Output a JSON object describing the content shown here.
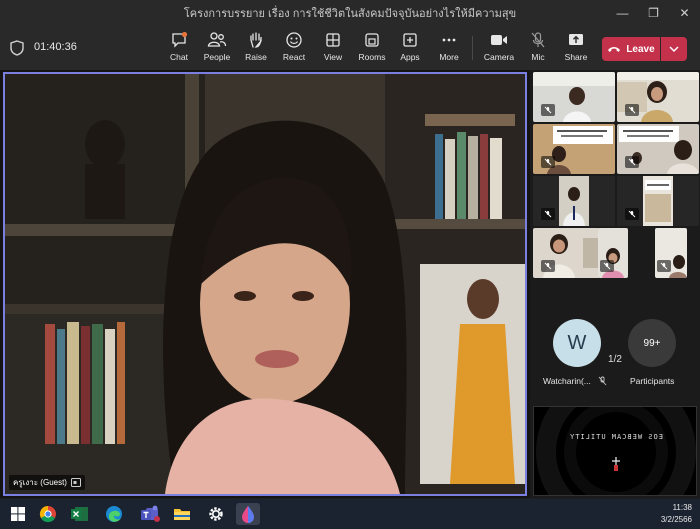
{
  "window": {
    "title": "โครงการบรรยาย เรื่อง การใช้ชีวิตในสังคมปัจจุบันอย่างไรให้มีความสุข",
    "minimize_icon": "minimize-icon",
    "maximize_icon": "restore-icon",
    "close_icon": "close-icon"
  },
  "meeting": {
    "timer": "01:40:36",
    "toolbar": [
      {
        "label": "Chat",
        "icon": "chat-icon"
      },
      {
        "label": "People",
        "icon": "people-icon"
      },
      {
        "label": "Raise",
        "icon": "raise-hand-icon"
      },
      {
        "label": "React",
        "icon": "smiley-icon"
      },
      {
        "label": "View",
        "icon": "grid-view-icon"
      },
      {
        "label": "Rooms",
        "icon": "rooms-icon"
      },
      {
        "label": "Apps",
        "icon": "add-apps-icon"
      },
      {
        "label": "More",
        "icon": "more-icon"
      },
      {
        "label": "Camera",
        "icon": "camera-icon"
      },
      {
        "label": "Mic",
        "icon": "mic-off-icon"
      },
      {
        "label": "Share",
        "icon": "share-icon"
      }
    ],
    "leave_label": "Leave",
    "accent_color": "#c4314b",
    "active_border_color": "#7b7fe0"
  },
  "main_video": {
    "participant_name": "ครูเงาะ (Guest)"
  },
  "gallery": {
    "page_indicator": "1/2",
    "thumb_slide_titles": [
      "ความหมายของชีวิต",
      "ประโยชน์ของการฝึกจิต",
      "ชีวิตที่ดีเริ่มต้นจากตัวเอง"
    ]
  },
  "attendees": [
    {
      "initial": "W",
      "name": "Watcharin(..."
    },
    {
      "count": "99+",
      "name": "Participants"
    }
  ],
  "webcam_overlay": {
    "text": "EOS WEBCAM UTILITY"
  },
  "taskbar": {
    "apps": [
      "start-icon",
      "chrome-icon",
      "excel-icon",
      "edge-icon",
      "teams-icon",
      "file-explorer-icon",
      "settings-icon",
      "paint-drop-icon"
    ],
    "time": "11:38",
    "date": "3/2/2566"
  }
}
